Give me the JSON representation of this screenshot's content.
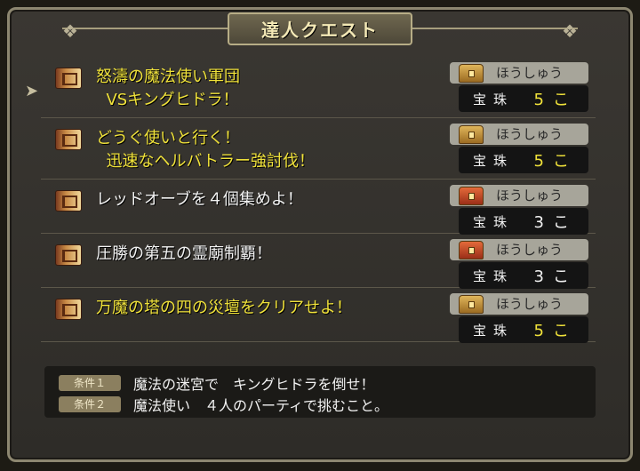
{
  "title": "達人クエスト",
  "reward_header": "ほうしゅう",
  "reward_item": "宝珠",
  "quests": [
    {
      "line1": "怒濤の魔法使い軍団",
      "line2": "  VSキングヒドラ！",
      "count": "5",
      "unit": "こ",
      "color": "gold",
      "chest": "gold"
    },
    {
      "line1": "どうぐ使いと行く！",
      "line2": "  迅速なヘルバトラー強討伐！",
      "count": "5",
      "unit": "こ",
      "color": "gold",
      "chest": "gold"
    },
    {
      "line1": "レッドオーブを４個集めよ！",
      "line2": "",
      "count": "3",
      "unit": "こ",
      "color": "white",
      "chest": "red"
    },
    {
      "line1": "圧勝の第五の霊廟制覇！",
      "line2": "",
      "count": "3",
      "unit": "こ",
      "color": "white",
      "chest": "red"
    },
    {
      "line1": "万魔の塔の四の災壇をクリアせよ！",
      "line2": "",
      "count": "5",
      "unit": "こ",
      "color": "gold",
      "chest": "gold"
    }
  ],
  "conditions": [
    {
      "tag": "条件１",
      "text": "魔法の迷宮で　キングヒドラを倒せ！"
    },
    {
      "tag": "条件２",
      "text": "魔法使い　４人のパーティで挑むこと。"
    }
  ]
}
